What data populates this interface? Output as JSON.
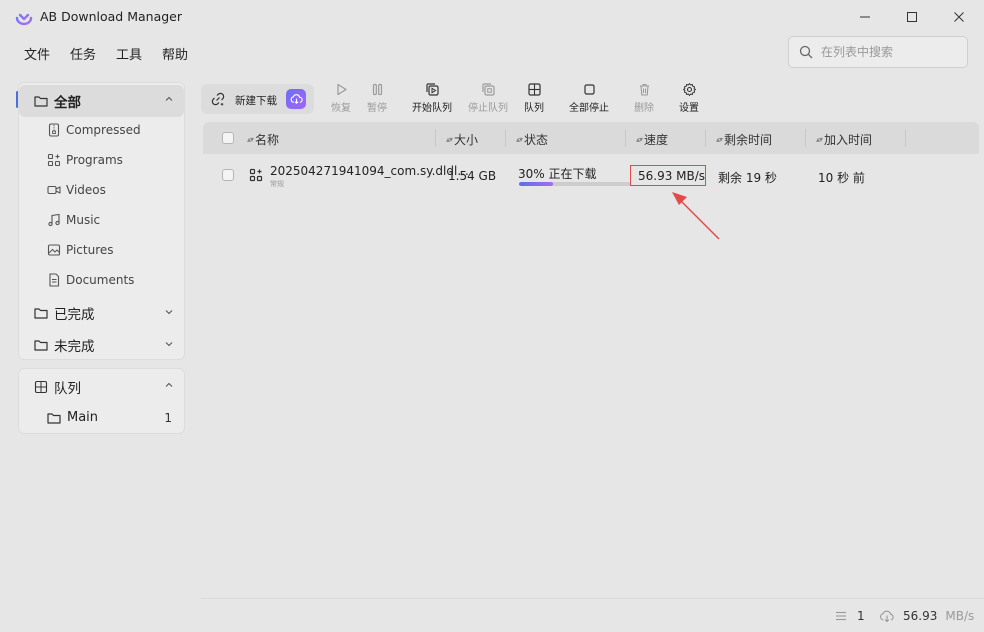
{
  "window": {
    "title": "AB Download Manager"
  },
  "menu": [
    "文件",
    "任务",
    "工具",
    "帮助"
  ],
  "search": {
    "placeholder": "在列表中搜索"
  },
  "sidebar": {
    "categories_title": "全部",
    "categories": [
      {
        "label": "Compressed",
        "icon": "archive-icon"
      },
      {
        "label": "Programs",
        "icon": "apps-icon"
      },
      {
        "label": "Videos",
        "icon": "video-icon"
      },
      {
        "label": "Music",
        "icon": "music-icon"
      },
      {
        "label": "Pictures",
        "icon": "image-icon"
      },
      {
        "label": "Documents",
        "icon": "document-icon"
      }
    ],
    "completed": "已完成",
    "incomplete": "未完成",
    "queue_title": "队列",
    "queues": [
      {
        "label": "Main",
        "count": "1"
      }
    ]
  },
  "toolbar": {
    "new_download": "新建下载",
    "resume": "恢复",
    "pause": "暂停",
    "start_queue": "开始队列",
    "stop_queue": "停止队列",
    "queue": "队列",
    "stop_all": "全部停止",
    "delete": "删除",
    "settings": "设置"
  },
  "table": {
    "columns": {
      "name": "名称",
      "size": "大小",
      "status": "状态",
      "speed": "速度",
      "remaining": "剩余时间",
      "added": "加入时间"
    },
    "rows": [
      {
        "name": "202504271941094_com.sy.dldl...",
        "sub": "常规",
        "size": "1.54 GB",
        "status": "30% 正在下载",
        "progress_percent": 30,
        "speed": "56.93 MB/s",
        "remaining": "剩余 19 秒",
        "added": "10 秒 前"
      }
    ]
  },
  "statusbar": {
    "active_count": "1",
    "speed_value": "56.93",
    "speed_unit": "MB/s"
  },
  "colors": {
    "accent": "#4a6fd8",
    "highlight_box": "#e34a4a"
  }
}
